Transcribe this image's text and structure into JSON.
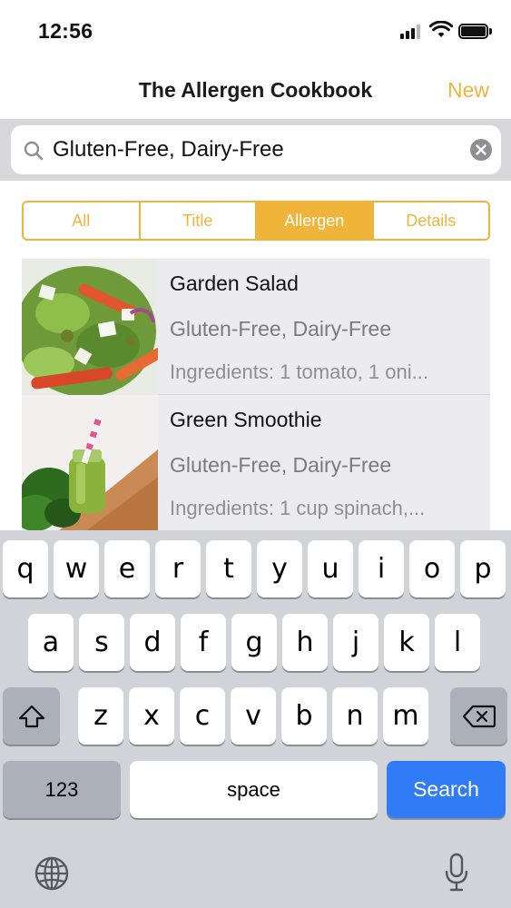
{
  "status_bar": {
    "time": "12:56",
    "signal_icon": "cellular-signal-icon",
    "wifi_icon": "wifi-icon",
    "battery_icon": "battery-icon"
  },
  "nav": {
    "title": "The Allergen Cookbook",
    "new_label": "New"
  },
  "search": {
    "value": "Gluten-Free, Dairy-Free",
    "placeholder": "",
    "search_icon": "magnifier-icon",
    "clear_icon": "clear-circle-icon"
  },
  "segments": [
    {
      "label": "All",
      "selected": false
    },
    {
      "label": "Title",
      "selected": false
    },
    {
      "label": "Allergen",
      "selected": true
    },
    {
      "label": "Details",
      "selected": false
    }
  ],
  "results": [
    {
      "title": "Garden Salad",
      "allergens": "Gluten-Free, Dairy-Free",
      "ingredients": "Ingredients: 1 tomato, 1 oni..."
    },
    {
      "title": "Green Smoothie",
      "allergens": "Gluten-Free, Dairy-Free",
      "ingredients": "Ingredients: 1 cup spinach,..."
    }
  ],
  "keyboard": {
    "row1": [
      "q",
      "w",
      "e",
      "r",
      "t",
      "y",
      "u",
      "i",
      "o",
      "p"
    ],
    "row2": [
      "a",
      "s",
      "d",
      "f",
      "g",
      "h",
      "j",
      "k",
      "l"
    ],
    "row3": [
      "z",
      "x",
      "c",
      "v",
      "b",
      "n",
      "m"
    ],
    "numbers_label": "123",
    "space_label": "space",
    "search_label": "Search",
    "shift_icon": "shift-arrow-icon",
    "delete_icon": "backspace-icon",
    "globe_icon": "globe-icon",
    "mic_icon": "microphone-icon"
  },
  "colors": {
    "accent": "#f0b43a",
    "search_key": "#2f7cf6",
    "keyboard_bg": "#d1d3d9"
  }
}
